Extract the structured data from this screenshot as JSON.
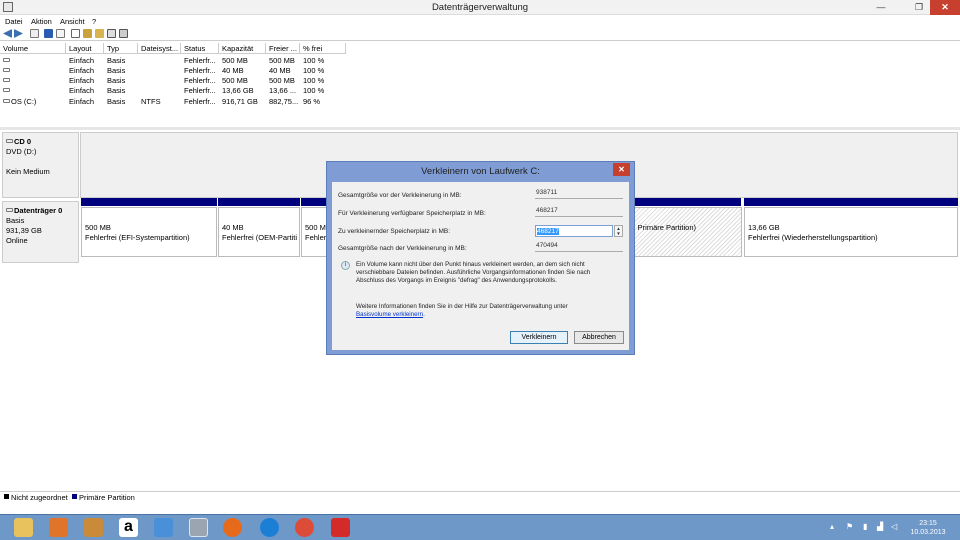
{
  "window": {
    "title": "Datenträgerverwaltung",
    "min": "—",
    "max": "❐",
    "close": "✕"
  },
  "menu": [
    "Datei",
    "Aktion",
    "Ansicht",
    "?"
  ],
  "columns": [
    "Volume",
    "Layout",
    "Typ",
    "Dateisyst...",
    "Status",
    "Kapazität",
    "Freier ...",
    "% frei"
  ],
  "rows": [
    [
      "",
      "Einfach",
      "Basis",
      "",
      "Fehlerfr...",
      "500 MB",
      "500 MB",
      "100 %"
    ],
    [
      "",
      "Einfach",
      "Basis",
      "",
      "Fehlerfr...",
      "40 MB",
      "40 MB",
      "100 %"
    ],
    [
      "",
      "Einfach",
      "Basis",
      "",
      "Fehlerfr...",
      "500 MB",
      "500 MB",
      "100 %"
    ],
    [
      "",
      "Einfach",
      "Basis",
      "",
      "Fehlerfr...",
      "13,66 GB",
      "13,66 ...",
      "100 %"
    ],
    [
      "OS (C:)",
      "Einfach",
      "Basis",
      "NTFS",
      "Fehlerfr...",
      "916,71 GB",
      "882,75...",
      "96 %"
    ]
  ],
  "cd": {
    "name": "CD 0",
    "line1": "DVD (D:)",
    "line2": "Kein Medium"
  },
  "disk0": {
    "name": "Datenträger 0",
    "type": "Basis",
    "size": "931,39 GB",
    "status": "Online",
    "partitions": [
      {
        "size": "500 MB",
        "desc": "Fehlerfrei (EFI-Systempartition)"
      },
      {
        "size": "40 MB",
        "desc": "Fehlerfrei (OEM-Partiti"
      },
      {
        "size": "500 M",
        "desc": "Fehlerf"
      },
      {
        "size": "",
        "desc": "), Primäre Partition)"
      },
      {
        "size": "13,66 GB",
        "desc": "Fehlerfrei (Wiederherstellungspartition)"
      }
    ]
  },
  "legend": {
    "unallocated": "Nicht zugeordnet",
    "primary": "Primäre Partition"
  },
  "dialog": {
    "title": "Verkleinern von Laufwerk C:",
    "total_before_label": "Gesamtgröße vor der Verkleinerung in MB:",
    "total_before": "938711",
    "available_label": "Für Verkleinerung verfügbarer Speicherplatz in MB:",
    "available": "468217",
    "shrink_label": "Zu verkleinernder Speicherplatz in MB:",
    "shrink_value": "468217",
    "total_after_label": "Gesamtgröße nach der Verkleinerung in MB:",
    "total_after": "470494",
    "info": "Ein Volume kann nicht über den Punkt hinaus verkleinert werden, an dem sich nicht verschiebbare Dateien befinden. Ausführliche Vorgangsinformationen finden Sie nach Abschluss des Vorgangs im Ereignis \"defrag\" des Anwendungsprotokolls.",
    "help_text": "Weitere Informationen finden Sie in der Hilfe zur Datenträgerverwaltung unter",
    "help_link": "Basisvolume verkleinern",
    "help_end": ".",
    "shrink_button": "Verkleinern",
    "cancel_button": "Abbrechen"
  },
  "taskbar": {
    "time": "23:15",
    "date": "10.03.2013"
  },
  "colors": {
    "accent": "#00007f",
    "dialog_frame": "#7f9dd4",
    "taskbar": "#6e98c8",
    "close": "#c7402f"
  }
}
